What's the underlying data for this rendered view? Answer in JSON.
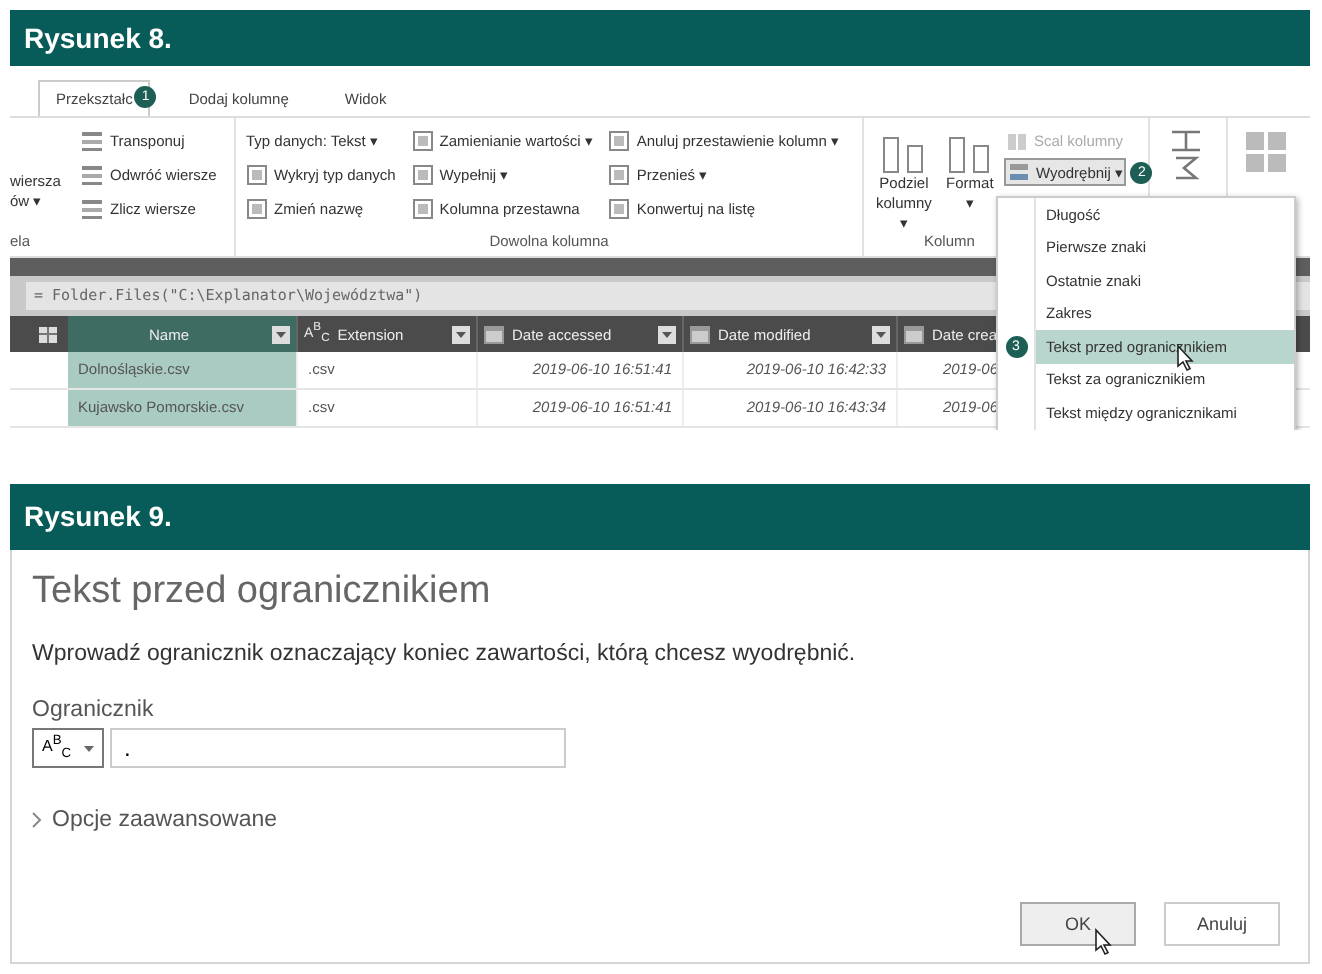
{
  "fig8": {
    "caption": "Rysunek 8.",
    "tabs": [
      {
        "label": "Przekształc",
        "selected": true,
        "badge": "1"
      },
      {
        "label": "Dodaj kolumnę",
        "selected": false
      },
      {
        "label": "Widok",
        "selected": false
      }
    ],
    "ribbon": {
      "cut_items": [
        "wiersza",
        "ów ▾"
      ],
      "cut_group": "ela",
      "stacks": [
        [
          "Transponuj",
          "Odwróć wiersze",
          "Zlicz wiersze"
        ],
        [
          "Typ danych: Tekst ▾",
          "Wykryj typ danych",
          "Zmień nazwę"
        ],
        [
          "Zamienianie wartości ▾",
          "Wypełnij ▾",
          "Kolumna przestawna"
        ],
        [
          "Anuluj przestawienie kolumn ▾",
          "Przenieś ▾",
          "Konwertuj na listę"
        ]
      ],
      "group_label": "Dowolna kolumna",
      "large": [
        {
          "lines": [
            "Podziel",
            "kolumny ▾"
          ]
        },
        {
          "lines": [
            "Format",
            "▾"
          ]
        }
      ],
      "merge": {
        "label": "Scal kolumny",
        "disabled": true
      },
      "extract": {
        "label": "Wyodrębnij ▾",
        "selected": true,
        "badge": "2"
      },
      "column_group": "Kolumn"
    },
    "formula": "= Folder.Files(\"C:\\Explanator\\Województwa\")",
    "columns": [
      {
        "label": "Name",
        "selected": true,
        "kind": "text"
      },
      {
        "label": "Extension",
        "selected": false,
        "kind": "abc",
        "type_text": "A$^{B}$$_{C}$"
      },
      {
        "label": "Date accessed",
        "selected": false,
        "kind": "date"
      },
      {
        "label": "Date modified",
        "selected": false,
        "kind": "date"
      },
      {
        "label": "Date crea",
        "selected": false,
        "kind": "date"
      }
    ],
    "rows": [
      [
        "Dolnośląskie.csv",
        ".csv",
        "2019-06-10 16:51:41",
        "2019-06-10 16:42:33",
        "2019-06"
      ],
      [
        "Kujawsko Pomorskie.csv",
        ".csv",
        "2019-06-10 16:51:41",
        "2019-06-10 16:43:34",
        "2019-06"
      ]
    ],
    "menu": [
      {
        "label": "Długość",
        "selected": false
      },
      {
        "label": "Pierwsze znaki",
        "selected": false
      },
      {
        "label": "Ostatnie znaki",
        "selected": false
      },
      {
        "label": "Zakres",
        "selected": false
      },
      {
        "label": "Tekst przed ogranicznikiem",
        "selected": true,
        "badge": "3"
      },
      {
        "label": "Tekst za ogranicznikiem",
        "selected": false
      },
      {
        "label": "Tekst między ogranicznikami",
        "selected": false
      }
    ]
  },
  "fig9": {
    "caption": "Rysunek 9.",
    "title": "Tekst przed ogranicznikiem",
    "description": "Wprowadź ogranicznik oznaczający koniec zawartości, którą chcesz wyodrębnić.",
    "field_label": "Ogranicznik",
    "type_text": "A$^{B}$$_{C}$",
    "value": ".",
    "advanced": "Opcje zaawansowane",
    "buttons": [
      {
        "label": "OK",
        "kind": "primary"
      },
      {
        "label": "Anuluj",
        "kind": "secondary"
      }
    ]
  }
}
